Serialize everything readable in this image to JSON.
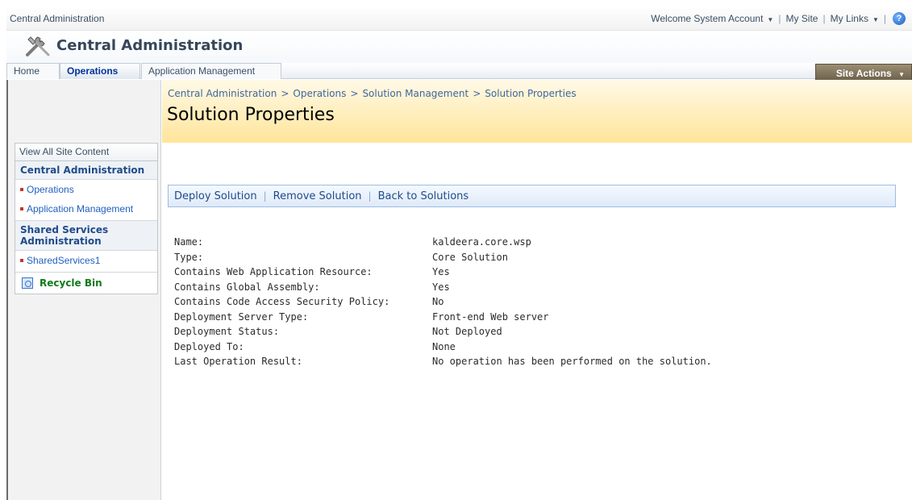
{
  "global": {
    "site_label": "Central Administration",
    "welcome": "Welcome System Account",
    "my_site": "My Site",
    "my_links": "My Links",
    "separator": "|"
  },
  "header": {
    "title": "Central Administration"
  },
  "topnav": {
    "tabs": [
      {
        "label": "Home",
        "selected": false
      },
      {
        "label": "Operations",
        "selected": true
      },
      {
        "label": "Application Management",
        "selected": false
      }
    ],
    "site_actions": "Site Actions"
  },
  "leftnav": {
    "view_all": "View All Site Content",
    "groups": [
      {
        "heading": "Central Administration",
        "items": [
          "Operations",
          "Application Management"
        ]
      },
      {
        "heading": "Shared Services Administration",
        "items": [
          "SharedServices1"
        ]
      }
    ],
    "recycle_bin": "Recycle Bin"
  },
  "page": {
    "breadcrumb": [
      "Central Administration",
      "Operations",
      "Solution Management",
      "Solution Properties"
    ],
    "breadcrumb_sep": ">",
    "title": "Solution Properties"
  },
  "toolbar": {
    "deploy": "Deploy Solution",
    "remove": "Remove Solution",
    "back": "Back to Solutions"
  },
  "properties": [
    {
      "label": "Name:",
      "value": "kaldeera.core.wsp"
    },
    {
      "label": "Type:",
      "value": "Core Solution"
    },
    {
      "label": "Contains Web Application Resource:",
      "value": "Yes"
    },
    {
      "label": "Contains Global Assembly:",
      "value": "Yes"
    },
    {
      "label": "Contains Code Access Security Policy:",
      "value": "No"
    },
    {
      "label": "Deployment Server Type:",
      "value": "Front-end Web server"
    },
    {
      "label": "Deployment Status:",
      "value": "Not Deployed"
    },
    {
      "label": "Deployed To:",
      "value": "None"
    },
    {
      "label": "Last Operation Result:",
      "value": "No operation has been performed on the solution."
    }
  ],
  "colors": {
    "accent": "#1f5fbf",
    "title_band": "#ffe59a",
    "site_actions": "#6c604a",
    "recycle": "#107a1a"
  }
}
